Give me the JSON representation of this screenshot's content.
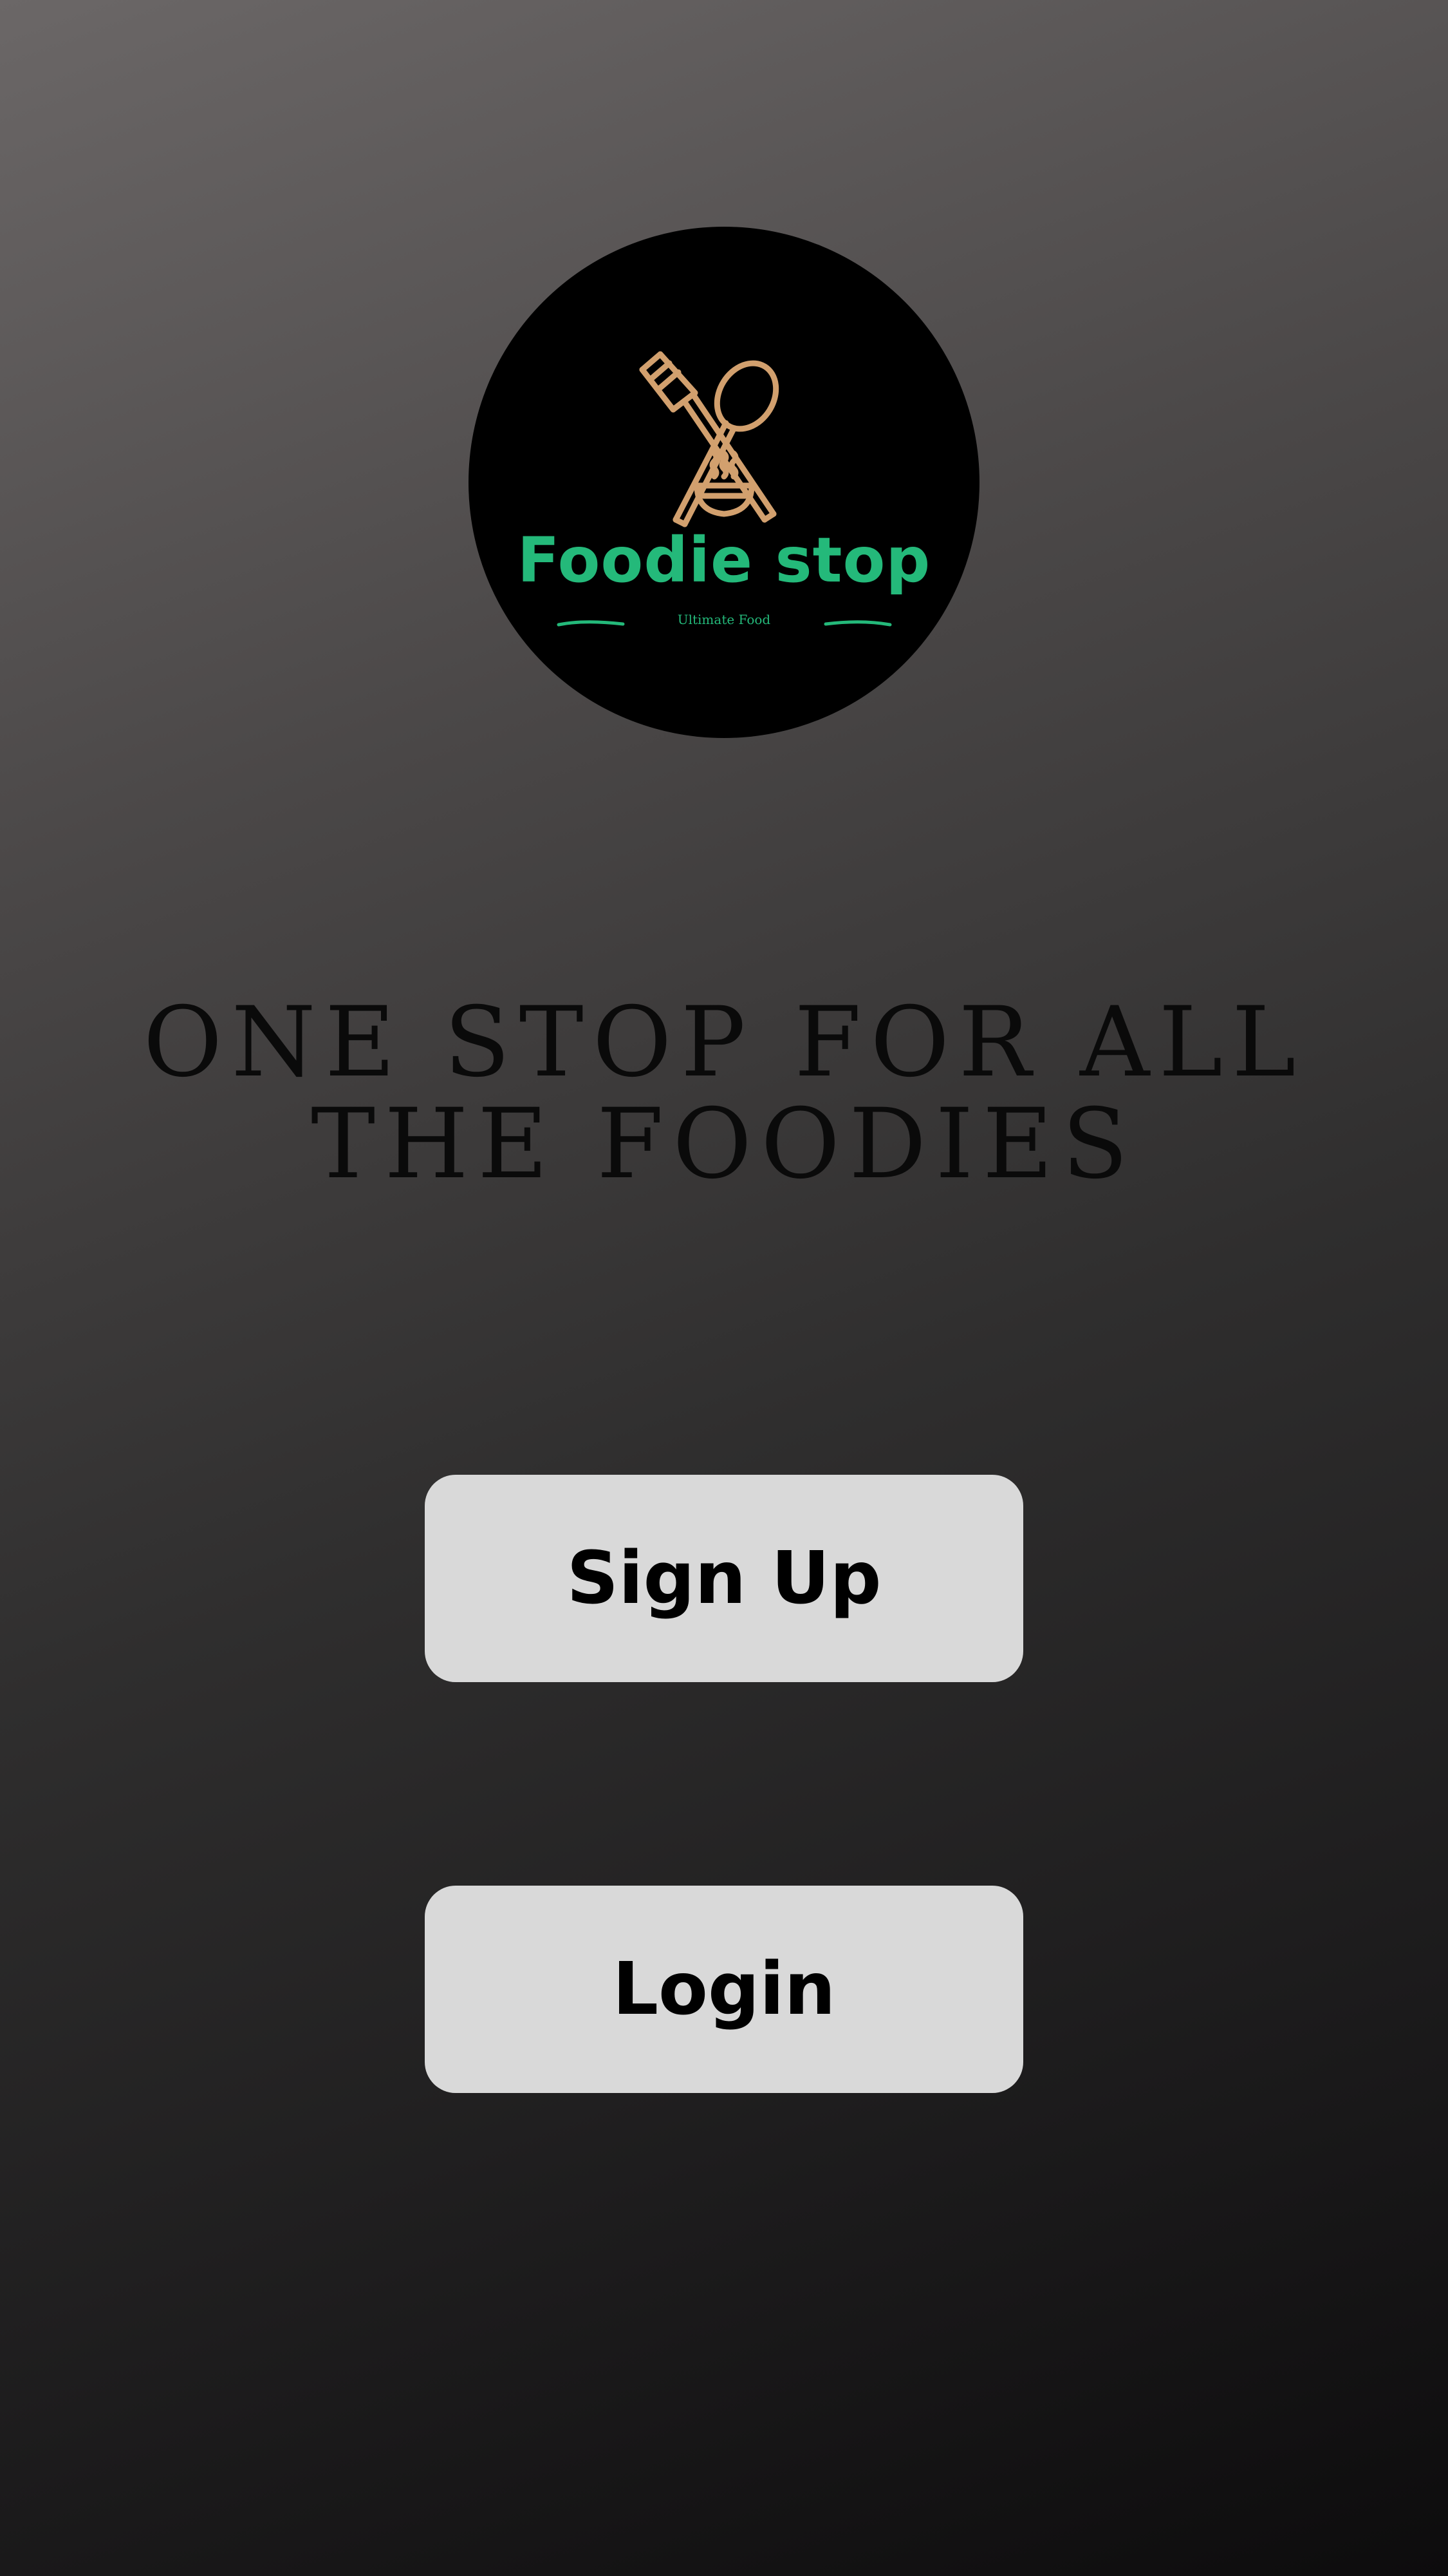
{
  "logo": {
    "brand_name": "Foodie stop",
    "tagline": "Ultimate Food",
    "icon": "fork-spoon-bowl-icon",
    "colors": {
      "background": "#000000",
      "brand_text": "#24b97a",
      "icon": "#d2a06e"
    }
  },
  "headline": {
    "line1": "ONE STOP FOR ALL",
    "line2": "THE FOODIES"
  },
  "buttons": {
    "signup_label": "Sign Up",
    "login_label": "Login"
  },
  "colors": {
    "button_background": "#d9d9d9",
    "button_text": "#000000",
    "headline_text": "#0a0a0a"
  }
}
